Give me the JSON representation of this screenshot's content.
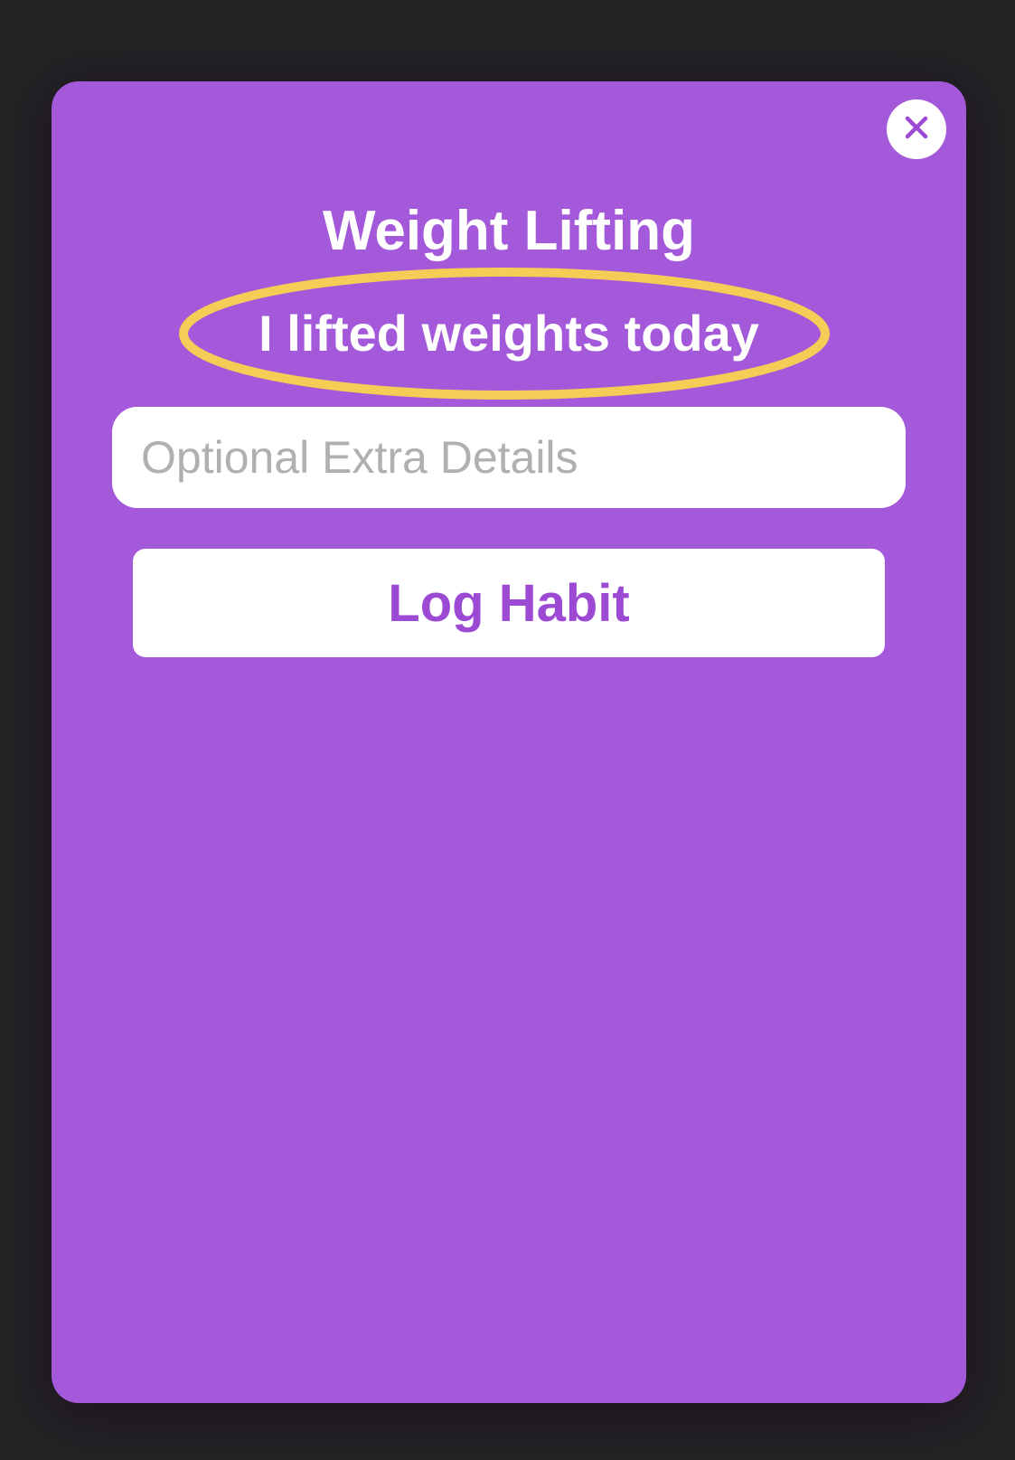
{
  "modal": {
    "title": "Weight Lifting",
    "subtitle": "I lifted weights today",
    "details_placeholder": "Optional Extra Details",
    "details_value": "",
    "log_button_label": "Log Habit",
    "close_icon": "close-icon"
  },
  "colors": {
    "background": "#242326",
    "modal": "#a359d9",
    "accent_text": "#9c4ad4",
    "highlight_ring": "#f5cc55"
  }
}
